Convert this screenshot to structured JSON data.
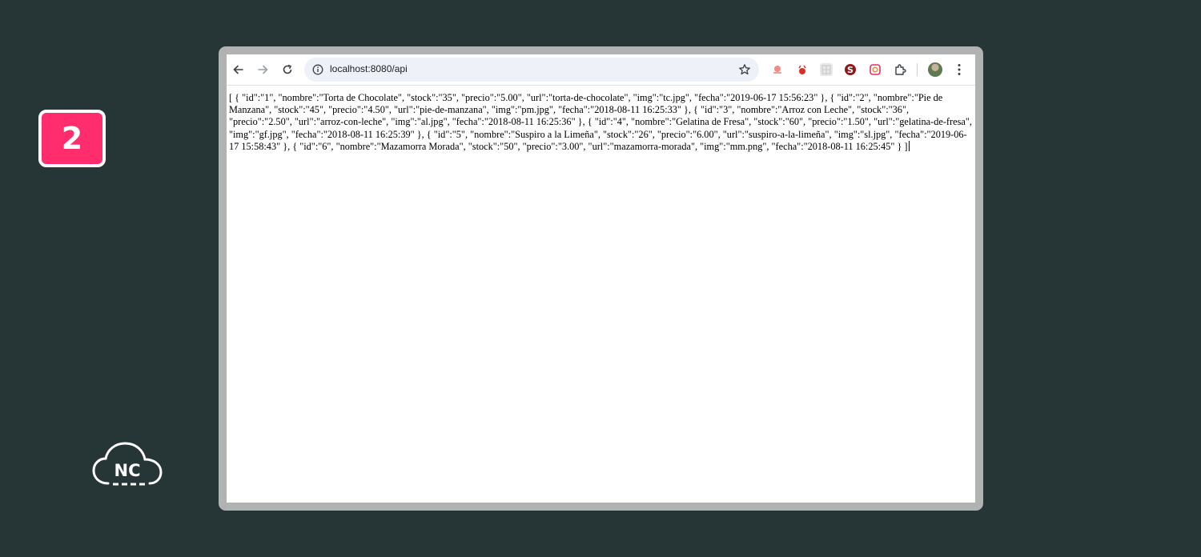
{
  "step_badge": {
    "number": "2"
  },
  "logo": {
    "text": "NC"
  },
  "browser": {
    "address": "localhost:8080/api",
    "extensions": [
      "record-icon",
      "devil-icon",
      "grid-icon",
      "s-extension-icon",
      "camera-icon",
      "puzzle-icon"
    ],
    "body_text": "[ { \"id\":\"1\", \"nombre\":\"Torta de Chocolate\", \"stock\":\"35\", \"precio\":\"5.00\", \"url\":\"torta-de-chocolate\", \"img\":\"tc.jpg\", \"fecha\":\"2019-06-17 15:56:23\" }, { \"id\":\"2\", \"nombre\":\"Pie de Manzana\", \"stock\":\"45\", \"precio\":\"4.50\", \"url\":\"pie-de-manzana\", \"img\":\"pm.jpg\", \"fecha\":\"2018-08-11 16:25:33\" }, { \"id\":\"3\", \"nombre\":\"Arroz con Leche\", \"stock\":\"36\", \"precio\":\"2.50\", \"url\":\"arroz-con-leche\", \"img\":\"al.jpg\", \"fecha\":\"2018-08-11 16:25:36\" }, { \"id\":\"4\", \"nombre\":\"Gelatina de Fresa\", \"stock\":\"60\", \"precio\":\"1.50\", \"url\":\"gelatina-de-fresa\", \"img\":\"gf.jpg\", \"fecha\":\"2018-08-11 16:25:39\" }, { \"id\":\"5\", \"nombre\":\"Suspiro a la Limeña\", \"stock\":\"26\", \"precio\":\"6.00\", \"url\":\"suspiro-a-la-limeña\", \"img\":\"sl.jpg\", \"fecha\":\"2019-06-17 15:58:43\" }, { \"id\":\"6\", \"nombre\":\"Mazamorra Morada\", \"stock\":\"50\", \"precio\":\"3.00\", \"url\":\"mazamorra-morada\", \"img\":\"mm.png\", \"fecha\":\"2018-08-11 16:25:45\" } ]"
  },
  "colors": {
    "background": "#263535",
    "badge": "#ff2d6e",
    "frame": "#b1b3b3"
  }
}
